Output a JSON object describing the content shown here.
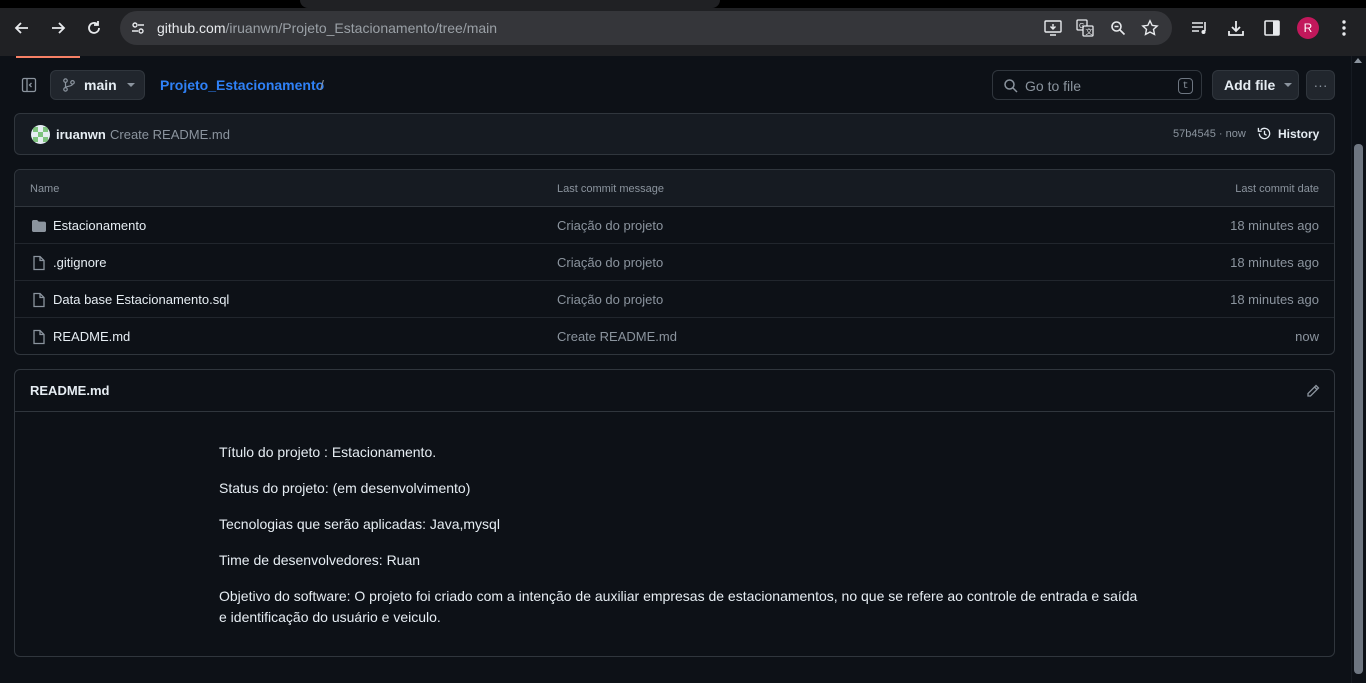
{
  "browser": {
    "url_host": "github.com",
    "url_path": "/iruanwn/Projeto_Estacionamento/tree/main",
    "profile_initial": "R",
    "icons": [
      "back-icon",
      "forward-icon",
      "reload-icon",
      "site-info-icon",
      "install-app-icon",
      "translate-icon",
      "zoom-icon",
      "bookmark-star-icon",
      "media-icon",
      "download-icon",
      "side-panel-icon",
      "menu-kebab-icon"
    ]
  },
  "toolbar": {
    "branch": "main",
    "repo_name": "Projeto_Estacionamento",
    "separator": "/",
    "goto_placeholder": "Go to file",
    "goto_shortcut": "t",
    "add_file": "Add file",
    "more": "···"
  },
  "commit": {
    "author": "iruanwn",
    "message": "Create README.md",
    "sha_time": "57b4545 · now",
    "history": "History"
  },
  "files": {
    "headers": {
      "name": "Name",
      "message": "Last commit message",
      "date": "Last commit date"
    },
    "rows": [
      {
        "type": "folder",
        "name": "Estacionamento",
        "message": "Criação do projeto",
        "date": "18 minutes ago"
      },
      {
        "type": "file",
        "name": ".gitignore",
        "message": "Criação do projeto",
        "date": "18 minutes ago"
      },
      {
        "type": "file",
        "name": "Data base Estacionamento.sql",
        "message": "Criação do projeto",
        "date": "18 minutes ago"
      },
      {
        "type": "file",
        "name": "README.md",
        "message": "Create README.md",
        "date": "now"
      }
    ]
  },
  "readme": {
    "title": "README.md",
    "lines": [
      "Título do projeto : Estacionamento.",
      "Status do projeto: (em desenvolvimento)",
      "Tecnologias que serão aplicadas: Java,mysql",
      "Time de desenvolvedores: Ruan",
      "Objetivo do software: O projeto foi criado com a intenção de auxiliar empresas de estacionamentos, no que se refere ao controle de entrada e saída e identificação do usuário e veiculo."
    ]
  },
  "colors": {
    "accent_link": "#2f81f7",
    "background": "#0d1117",
    "border": "#30363d",
    "underline": "#f78166",
    "profile": "#c2185b"
  }
}
